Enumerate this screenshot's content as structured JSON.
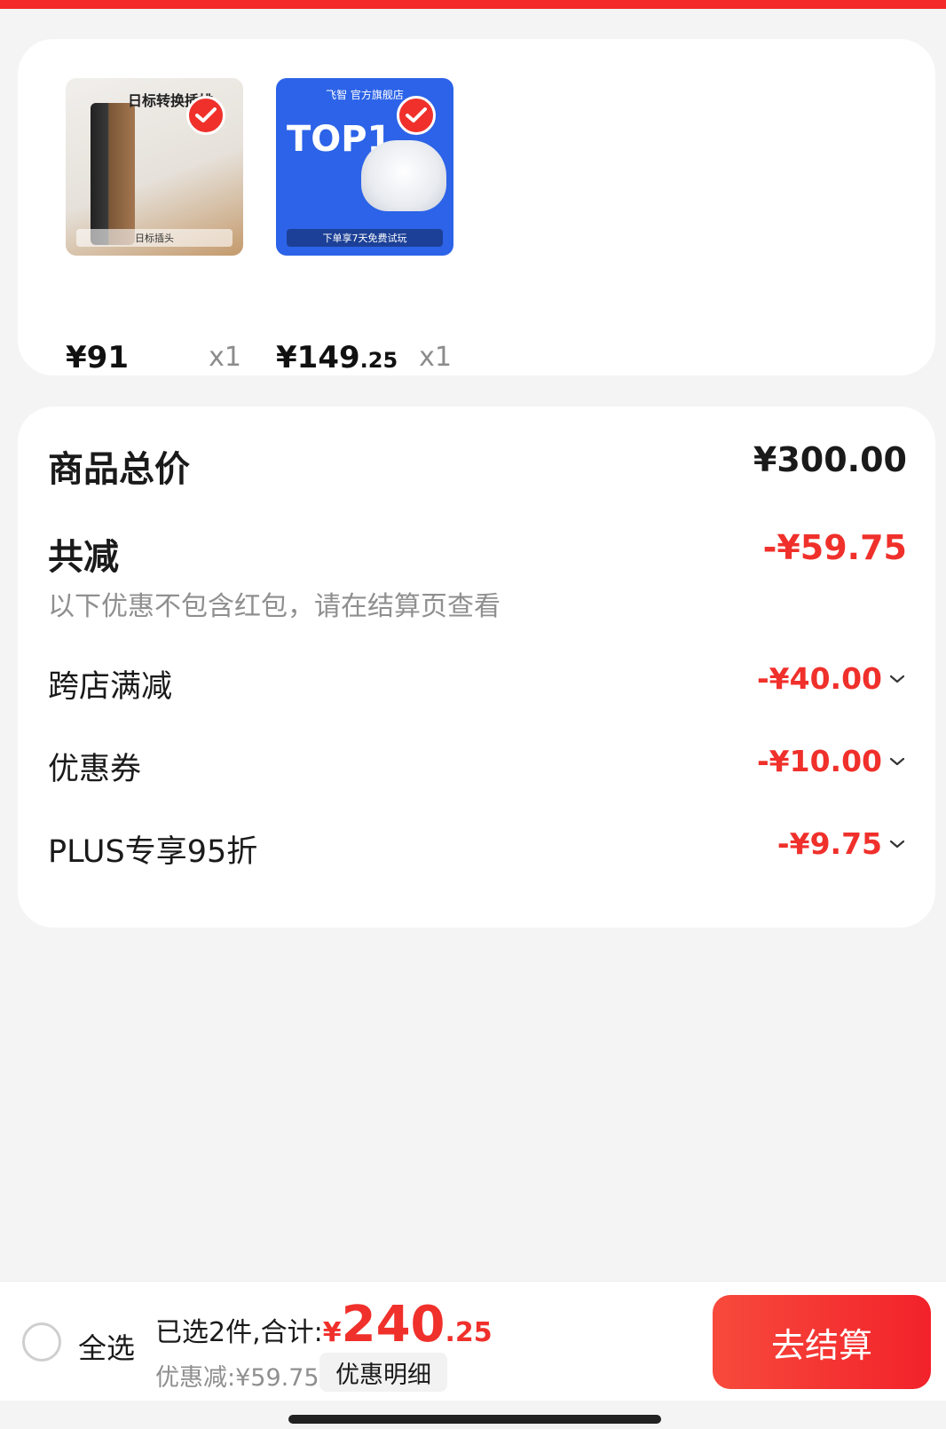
{
  "colors": {
    "accent_red": "#f0302b",
    "page_bg": "#f4f4f4",
    "card_bg": "#ffffff",
    "muted_text": "#8f8f8f"
  },
  "products": [
    {
      "image_title": "日标转换插排",
      "image_tag": "日标插头",
      "price_int": "¥91",
      "price_dec": "",
      "quantity": "x1",
      "selected": true,
      "icon": "check-icon"
    },
    {
      "image_brand": "飞智 官方旗舰店",
      "image_title": "TOP1",
      "image_tag": "下单享7天免费试玩",
      "price_int": "¥149",
      "price_dec": ".25",
      "quantity": "x1",
      "selected": true,
      "icon": "check-icon"
    }
  ],
  "summary": {
    "total_label": "商品总价",
    "total_value": "¥300.00",
    "reduce_label": "共减",
    "reduce_value": "-¥59.75",
    "note": "以下优惠不包含红包，请在结算页查看",
    "items": [
      {
        "label": "跨店满减",
        "value": "-¥40.00",
        "icon": "chevron-down-icon"
      },
      {
        "label": "优惠券",
        "value": "-¥10.00",
        "icon": "chevron-down-icon"
      },
      {
        "label": "PLUS专享95折",
        "value": "-¥9.75",
        "icon": "chevron-down-icon"
      }
    ]
  },
  "bottom_bar": {
    "select_all": "全选",
    "selected_text": "已选2件,合计:",
    "total_yen": "¥",
    "total_int": "240",
    "total_dec": ".25",
    "discount_text": "优惠减:¥59.75",
    "detail_button": "优惠明细",
    "checkout_button": "去结算"
  }
}
